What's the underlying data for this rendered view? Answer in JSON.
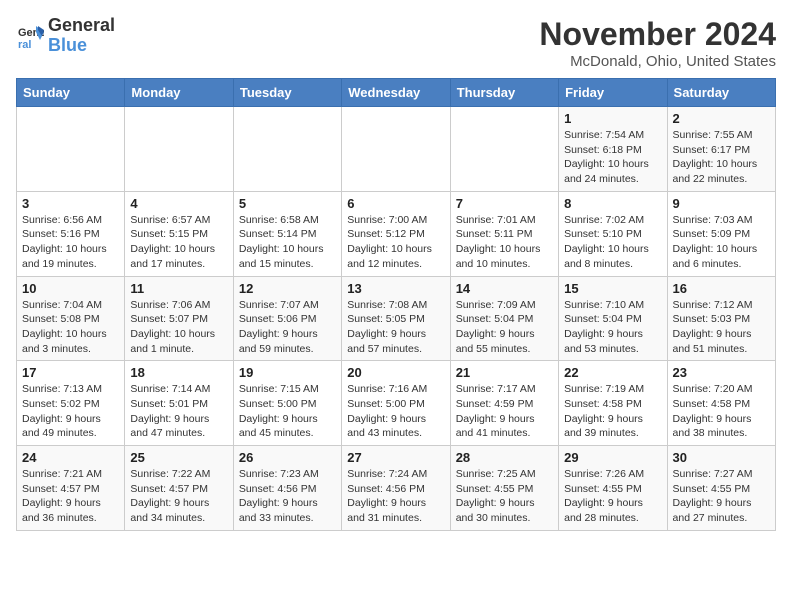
{
  "logo": {
    "line1": "General",
    "line2": "Blue"
  },
  "title": "November 2024",
  "location": "McDonald, Ohio, United States",
  "days_header": [
    "Sunday",
    "Monday",
    "Tuesday",
    "Wednesday",
    "Thursday",
    "Friday",
    "Saturday"
  ],
  "weeks": [
    [
      {
        "day": "",
        "info": ""
      },
      {
        "day": "",
        "info": ""
      },
      {
        "day": "",
        "info": ""
      },
      {
        "day": "",
        "info": ""
      },
      {
        "day": "",
        "info": ""
      },
      {
        "day": "1",
        "info": "Sunrise: 7:54 AM\nSunset: 6:18 PM\nDaylight: 10 hours and 24 minutes."
      },
      {
        "day": "2",
        "info": "Sunrise: 7:55 AM\nSunset: 6:17 PM\nDaylight: 10 hours and 22 minutes."
      }
    ],
    [
      {
        "day": "3",
        "info": "Sunrise: 6:56 AM\nSunset: 5:16 PM\nDaylight: 10 hours and 19 minutes."
      },
      {
        "day": "4",
        "info": "Sunrise: 6:57 AM\nSunset: 5:15 PM\nDaylight: 10 hours and 17 minutes."
      },
      {
        "day": "5",
        "info": "Sunrise: 6:58 AM\nSunset: 5:14 PM\nDaylight: 10 hours and 15 minutes."
      },
      {
        "day": "6",
        "info": "Sunrise: 7:00 AM\nSunset: 5:12 PM\nDaylight: 10 hours and 12 minutes."
      },
      {
        "day": "7",
        "info": "Sunrise: 7:01 AM\nSunset: 5:11 PM\nDaylight: 10 hours and 10 minutes."
      },
      {
        "day": "8",
        "info": "Sunrise: 7:02 AM\nSunset: 5:10 PM\nDaylight: 10 hours and 8 minutes."
      },
      {
        "day": "9",
        "info": "Sunrise: 7:03 AM\nSunset: 5:09 PM\nDaylight: 10 hours and 6 minutes."
      }
    ],
    [
      {
        "day": "10",
        "info": "Sunrise: 7:04 AM\nSunset: 5:08 PM\nDaylight: 10 hours and 3 minutes."
      },
      {
        "day": "11",
        "info": "Sunrise: 7:06 AM\nSunset: 5:07 PM\nDaylight: 10 hours and 1 minute."
      },
      {
        "day": "12",
        "info": "Sunrise: 7:07 AM\nSunset: 5:06 PM\nDaylight: 9 hours and 59 minutes."
      },
      {
        "day": "13",
        "info": "Sunrise: 7:08 AM\nSunset: 5:05 PM\nDaylight: 9 hours and 57 minutes."
      },
      {
        "day": "14",
        "info": "Sunrise: 7:09 AM\nSunset: 5:04 PM\nDaylight: 9 hours and 55 minutes."
      },
      {
        "day": "15",
        "info": "Sunrise: 7:10 AM\nSunset: 5:04 PM\nDaylight: 9 hours and 53 minutes."
      },
      {
        "day": "16",
        "info": "Sunrise: 7:12 AM\nSunset: 5:03 PM\nDaylight: 9 hours and 51 minutes."
      }
    ],
    [
      {
        "day": "17",
        "info": "Sunrise: 7:13 AM\nSunset: 5:02 PM\nDaylight: 9 hours and 49 minutes."
      },
      {
        "day": "18",
        "info": "Sunrise: 7:14 AM\nSunset: 5:01 PM\nDaylight: 9 hours and 47 minutes."
      },
      {
        "day": "19",
        "info": "Sunrise: 7:15 AM\nSunset: 5:00 PM\nDaylight: 9 hours and 45 minutes."
      },
      {
        "day": "20",
        "info": "Sunrise: 7:16 AM\nSunset: 5:00 PM\nDaylight: 9 hours and 43 minutes."
      },
      {
        "day": "21",
        "info": "Sunrise: 7:17 AM\nSunset: 4:59 PM\nDaylight: 9 hours and 41 minutes."
      },
      {
        "day": "22",
        "info": "Sunrise: 7:19 AM\nSunset: 4:58 PM\nDaylight: 9 hours and 39 minutes."
      },
      {
        "day": "23",
        "info": "Sunrise: 7:20 AM\nSunset: 4:58 PM\nDaylight: 9 hours and 38 minutes."
      }
    ],
    [
      {
        "day": "24",
        "info": "Sunrise: 7:21 AM\nSunset: 4:57 PM\nDaylight: 9 hours and 36 minutes."
      },
      {
        "day": "25",
        "info": "Sunrise: 7:22 AM\nSunset: 4:57 PM\nDaylight: 9 hours and 34 minutes."
      },
      {
        "day": "26",
        "info": "Sunrise: 7:23 AM\nSunset: 4:56 PM\nDaylight: 9 hours and 33 minutes."
      },
      {
        "day": "27",
        "info": "Sunrise: 7:24 AM\nSunset: 4:56 PM\nDaylight: 9 hours and 31 minutes."
      },
      {
        "day": "28",
        "info": "Sunrise: 7:25 AM\nSunset: 4:55 PM\nDaylight: 9 hours and 30 minutes."
      },
      {
        "day": "29",
        "info": "Sunrise: 7:26 AM\nSunset: 4:55 PM\nDaylight: 9 hours and 28 minutes."
      },
      {
        "day": "30",
        "info": "Sunrise: 7:27 AM\nSunset: 4:55 PM\nDaylight: 9 hours and 27 minutes."
      }
    ]
  ]
}
